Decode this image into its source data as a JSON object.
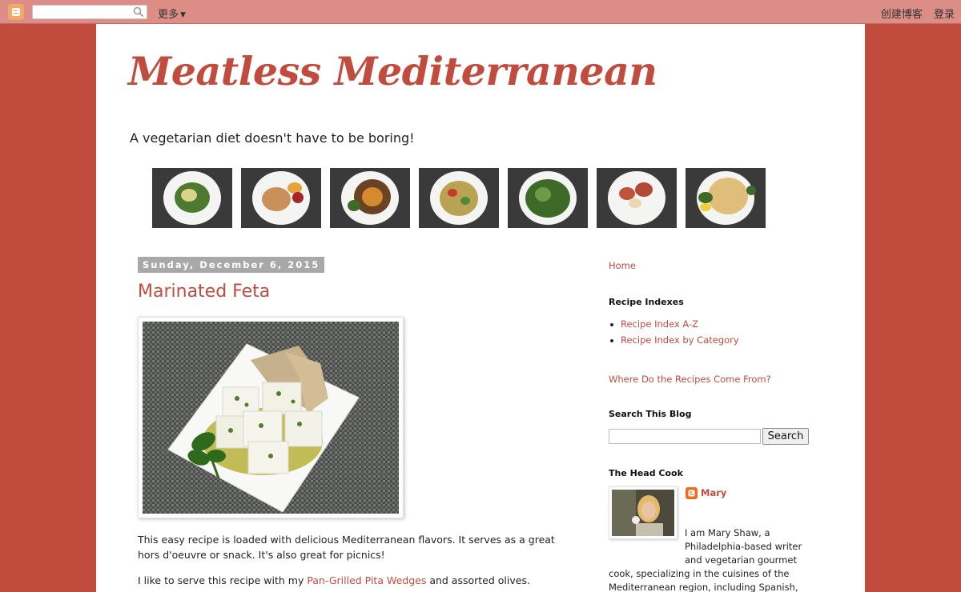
{
  "navbar": {
    "more_label": "更多",
    "create_blog_label": "创建博客",
    "login_label": "登录",
    "search_value": ""
  },
  "blog": {
    "title": "Meatless Mediterranean",
    "description": "A vegetarian diet doesn't have to be boring!"
  },
  "post": {
    "date": "Sunday, December 6, 2015",
    "title": "Marinated Feta",
    "p1": "This easy recipe is loaded with delicious Mediterranean flavors. It serves as a great hors d'oeuvre or snack. It's also great for picnics!",
    "p2_before": "I like to serve this recipe with my ",
    "p2_link": "Pan-Grilled Pita Wedges",
    "p2_after": " and assorted olives."
  },
  "sidebar": {
    "home_label": "Home",
    "recipe_indexes_heading": "Recipe Indexes",
    "recipe_indexes": [
      "Recipe Index A-Z",
      "Recipe Index by Category"
    ],
    "where_label": "Where Do the Recipes Come From?",
    "search_heading": "Search This Blog",
    "search_value": "",
    "search_button": "Search",
    "head_cook_heading": "The Head Cook",
    "author_name": "Mary",
    "bio": "I am Mary Shaw, a Philadelphia-based writer and vegetarian gourmet cook, specializing in the cuisines of the Mediterranean region, including Spanish, French, Italian, Greek, Israeli, Moroccan, and"
  },
  "colors": {
    "accent": "#c14c3e",
    "navbar": "#dc8e86",
    "date_badge": "#a8a8a8"
  }
}
